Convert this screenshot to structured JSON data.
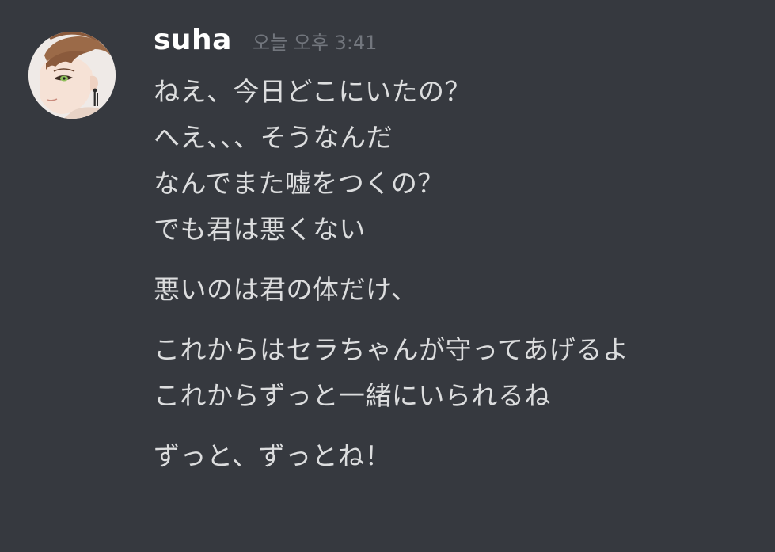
{
  "message": {
    "author": "suha",
    "timestamp": "오늘 오후 3:41",
    "avatar_icon": "anime-character-avatar",
    "lines": [
      "ねえ、今日どこにいたの？",
      "へえ、、、そうなんだ",
      "なんでまた嘘をつくの？",
      "でも君は悪くない",
      "悪いのは君の体だけ、",
      "これからはセラちゃんが守ってあげるよ",
      "これからずっと一緒にいられるね",
      "ずっと、ずっとね！"
    ]
  },
  "colors": {
    "background": "#36393f",
    "username": "#ffffff",
    "timestamp": "#72767d",
    "message_text": "#dcddde"
  }
}
